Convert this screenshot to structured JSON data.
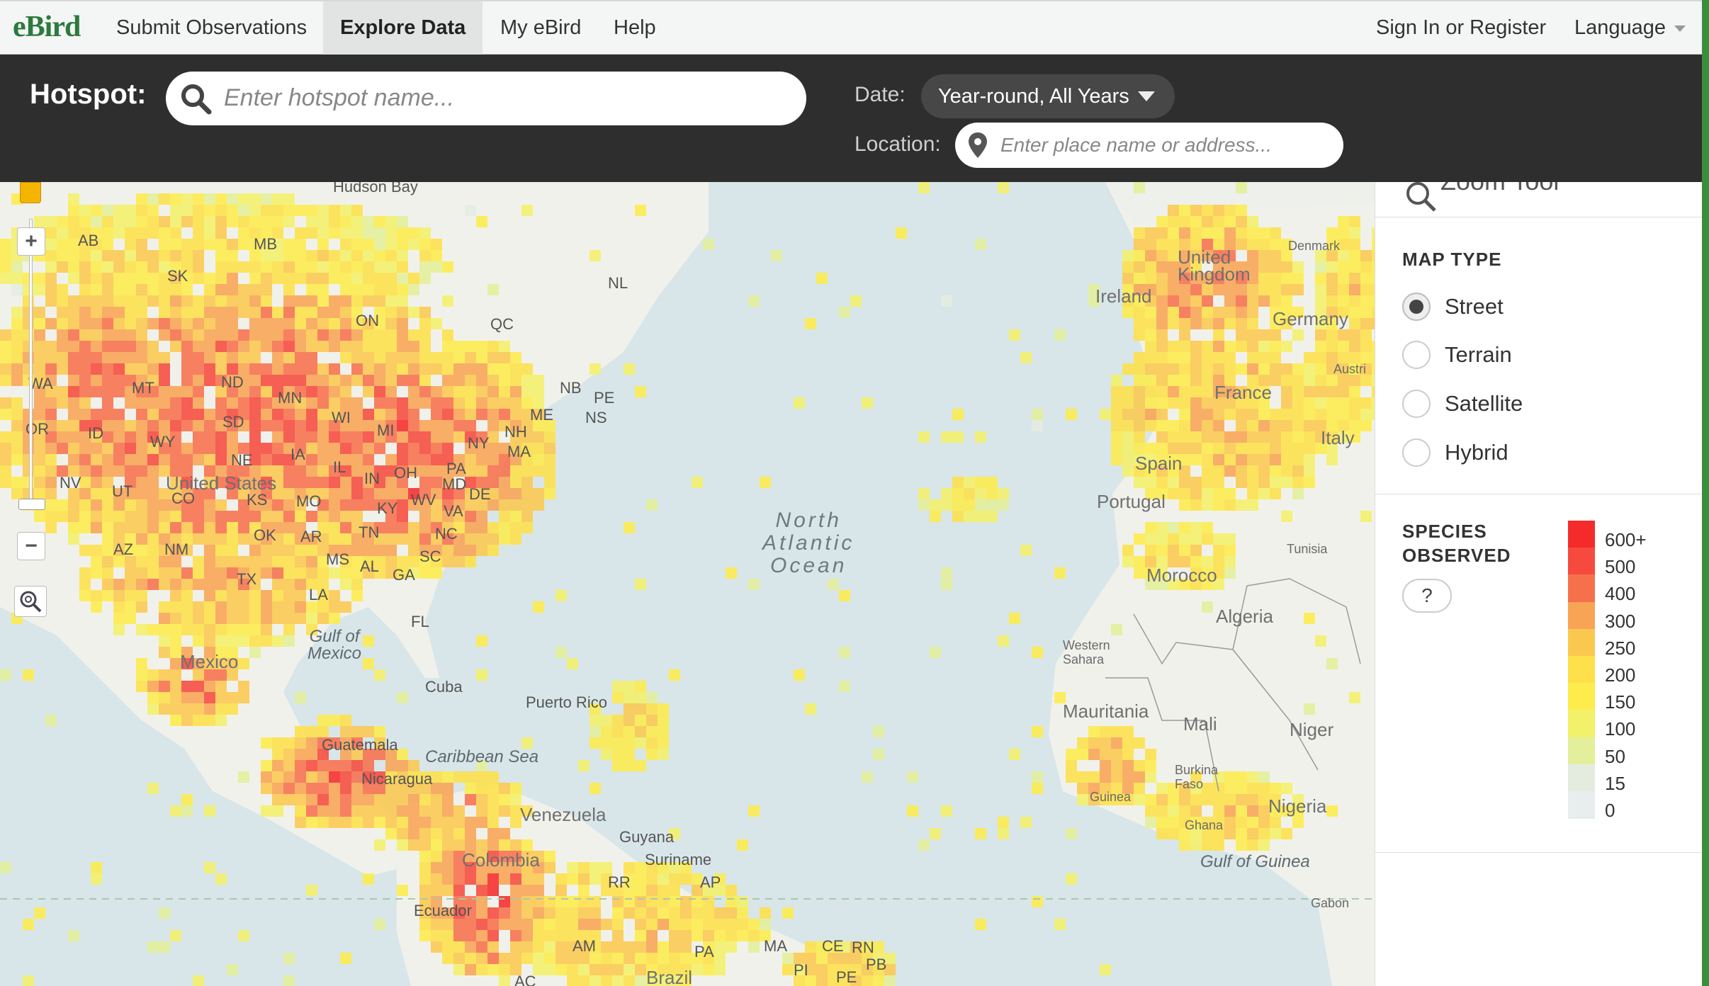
{
  "nav": {
    "logo": "eBird",
    "items": [
      "Submit Observations",
      "Explore Data",
      "My eBird",
      "Help"
    ],
    "active": "Explore Data",
    "sign_in": "Sign In or Register",
    "language": "Language"
  },
  "search": {
    "hotspot_label": "Hotspot:",
    "hotspot_placeholder": "Enter hotspot name...",
    "date_label": "Date:",
    "date_value": "Year-round, All Years",
    "location_label": "Location:",
    "location_placeholder": "Enter place name or address..."
  },
  "panel": {
    "zoom_tool": "Zoom Tool",
    "map_type_heading": "MAP TYPE",
    "map_types": [
      "Street",
      "Terrain",
      "Satellite",
      "Hybrid"
    ],
    "selected_map_type": "Street",
    "species_heading_1": "SPECIES",
    "species_heading_2": "OBSERVED",
    "help_label": "?",
    "legend": [
      {
        "label": "600+",
        "color": "#f52b2b"
      },
      {
        "label": "500",
        "color": "#f64a3e"
      },
      {
        "label": "400",
        "color": "#f7704c"
      },
      {
        "label": "300",
        "color": "#f8a454"
      },
      {
        "label": "250",
        "color": "#fbc84f"
      },
      {
        "label": "200",
        "color": "#fde04a"
      },
      {
        "label": "150",
        "color": "#fdec4c"
      },
      {
        "label": "100",
        "color": "#f3f06a"
      },
      {
        "label": "50",
        "color": "#e3ef9a"
      },
      {
        "label": "15",
        "color": "#e4ece0"
      },
      {
        "label": "0",
        "color": "#e7eeed"
      }
    ]
  },
  "map": {
    "labels": {
      "hudson_bay": "Hudson Bay",
      "ab": "AB",
      "mb": "MB",
      "sk": "SK",
      "nl": "NL",
      "on": "ON",
      "qc": "QC",
      "mt": "MT",
      "nd": "ND",
      "mn": "MN",
      "wa": "WA",
      "or": "OR",
      "id": "ID",
      "sd": "SD",
      "wy": "WY",
      "wi": "WI",
      "mi": "MI",
      "ny": "NY",
      "nh": "NH",
      "ma": "MA",
      "me": "ME",
      "nb": "NB",
      "pe": "PE",
      "ns": "NS",
      "ne": "NE",
      "ia": "IA",
      "il": "IL",
      "in": "IN",
      "oh": "OH",
      "pa": "PA",
      "md": "MD",
      "de": "DE",
      "nv": "NV",
      "ut": "UT",
      "co": "CO",
      "ks": "KS",
      "mo": "MO",
      "ky": "KY",
      "wv": "WV",
      "va": "VA",
      "ok": "OK",
      "ar": "AR",
      "tn": "TN",
      "nc": "NC",
      "az": "AZ",
      "nm": "NM",
      "ms": "MS",
      "al": "AL",
      "ga": "GA",
      "sc": "SC",
      "tx": "TX",
      "la": "LA",
      "fl": "FL",
      "united_states": "United States",
      "gulf_of_mexico": "Gulf of\nMexico",
      "mexico": "Mexico",
      "cuba": "Cuba",
      "puerto_rico": "Puerto Rico",
      "caribbean_sea": "Caribbean Sea",
      "guatemala": "Guatemala",
      "nicaragua": "Nicaragua",
      "venezuela": "Venezuela",
      "guyana": "Guyana",
      "suriname": "Suriname",
      "colombia": "Colombia",
      "rr": "RR",
      "ap": "AP",
      "ecuador": "Ecuador",
      "am": "AM",
      "pa_br": "PA",
      "ma_br": "MA",
      "ce": "CE",
      "rn": "RN",
      "pb": "PB",
      "pi": "PI",
      "pe_br": "PE",
      "ac": "AC",
      "brazil": "Brazil",
      "north_atlantic_ocean": "North\nAtlantic\nOcean",
      "ireland": "Ireland",
      "united_kingdom": "United\nKingdom",
      "denmark": "Denmark",
      "germany": "Germany",
      "austria": "Austri",
      "france": "France",
      "italy": "Italy",
      "spain": "Spain",
      "portugal": "Portugal",
      "tunisia": "Tunisia",
      "morocco": "Morocco",
      "algeria": "Algeria",
      "western_sahara": "Western\nSahara",
      "mauritania": "Mauritania",
      "mali": "Mali",
      "niger": "Niger",
      "burkina_faso": "Burkina\nFaso",
      "guinea": "Guinea",
      "ghana": "Ghana",
      "nigeria": "Nigeria",
      "gulf_of_guinea": "Gulf of Guinea",
      "gabon": "Gabon"
    }
  }
}
